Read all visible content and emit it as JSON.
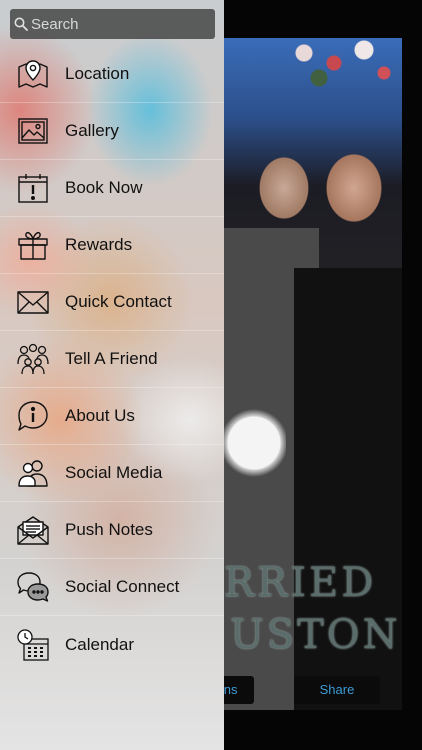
{
  "search": {
    "placeholder": "Search",
    "icon": "search-icon"
  },
  "menu": {
    "items": [
      {
        "label": "Location",
        "icon": "map-pin-icon"
      },
      {
        "label": "Gallery",
        "icon": "image-icon"
      },
      {
        "label": "Book Now",
        "icon": "calendar-alert-icon"
      },
      {
        "label": "Rewards",
        "icon": "gift-icon"
      },
      {
        "label": "Quick Contact",
        "icon": "envelope-icon"
      },
      {
        "label": "Tell A Friend",
        "icon": "people-icon"
      },
      {
        "label": "About Us",
        "icon": "info-icon"
      },
      {
        "label": "Social Media",
        "icon": "users-icon"
      },
      {
        "label": "Push Notes",
        "icon": "open-envelope-icon"
      },
      {
        "label": "Social Connect",
        "icon": "chat-bubbles-icon"
      },
      {
        "label": "Calendar",
        "icon": "calendar-clock-icon"
      }
    ]
  },
  "background": {
    "banner_line1": "RRIED",
    "banner_line2": "USTON",
    "tab_left": "ons",
    "tab_share": "Share"
  },
  "colors": {
    "accent": "#3d9bd6",
    "drawer_text": "#111111",
    "search_bg": "#464646"
  }
}
